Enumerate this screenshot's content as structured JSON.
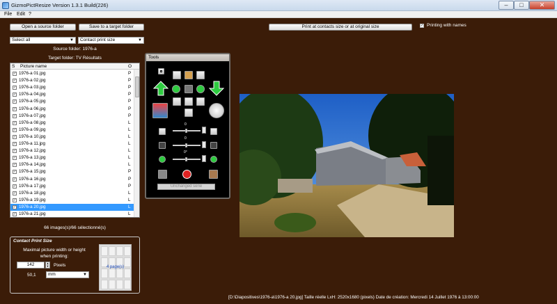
{
  "window": {
    "title": "GizmoPictResize  Version 1.3.1 Build(226)",
    "minimize": "–",
    "maximize": "□",
    "close": "✕"
  },
  "menu": [
    "File",
    "Edit",
    "?"
  ],
  "toolbar": {
    "open_source": "Open a source folder",
    "save_target": "Save to a target folder",
    "print_btn": "Print at contacts size or at original size",
    "printing_with_names": "Printing with names"
  },
  "selects": {
    "selection": "Select all",
    "mode": "Contact print size"
  },
  "folders": {
    "source": "Source folder: 1976-a",
    "target": "Target folder: TV Résultats"
  },
  "list": {
    "headers": {
      "s": "S",
      "name": "Picture name",
      "o": "O"
    },
    "rows": [
      {
        "name": "1976-a 01.jpg",
        "o": "P"
      },
      {
        "name": "1976-a 02.jpg",
        "o": "P"
      },
      {
        "name": "1976-a 03.jpg",
        "o": "P"
      },
      {
        "name": "1976-a 04.jpg",
        "o": "P"
      },
      {
        "name": "1976-a 05.jpg",
        "o": "P"
      },
      {
        "name": "1976-a 06.jpg",
        "o": "P"
      },
      {
        "name": "1976-a 07.jpg",
        "o": "P"
      },
      {
        "name": "1976-a 08.jpg",
        "o": "L"
      },
      {
        "name": "1976-a 09.jpg",
        "o": "L"
      },
      {
        "name": "1976-a 10.jpg",
        "o": "L"
      },
      {
        "name": "1976-a 11.jpg",
        "o": "L"
      },
      {
        "name": "1976-a 12.jpg",
        "o": "L"
      },
      {
        "name": "1976-a 13.jpg",
        "o": "L"
      },
      {
        "name": "1976-a 14.jpg",
        "o": "L"
      },
      {
        "name": "1976-a 15.jpg",
        "o": "P"
      },
      {
        "name": "1976-a 16.jpg",
        "o": "P"
      },
      {
        "name": "1976-a 17.jpg",
        "o": "P"
      },
      {
        "name": "1976-a 18.jpg",
        "o": "L"
      },
      {
        "name": "1976-a 19.jpg",
        "o": "L"
      },
      {
        "name": "1976-a 20.jpg",
        "o": "L"
      },
      {
        "name": "1976-a 21.jpg",
        "o": "L"
      }
    ],
    "selected_index": 19,
    "count": "66 images(s)/66 sélectionné(s)"
  },
  "tools": {
    "title": "Tools",
    "slider1_value": "0",
    "slider2_value": "0",
    "slider3_value": "0°",
    "unchanged": "Unchanged serie"
  },
  "contact": {
    "title": "Contact Print Size",
    "desc1": "Maximal picture width or height",
    "desc2": "when printing:",
    "width_value": "142",
    "unit_pixels": "Pixels",
    "mm_value": "50,1",
    "unit_select": "mm",
    "pages": "4 page(s)"
  },
  "status": {
    "text": "[D:\\Diapositives\\1976-a\\1976-a 20.jpg]   Taille réelle LxH: 2520x1680 (pixels)   Date de création: Mercredi 14 Juillet 1976 à 13:00:00"
  },
  "colors": {
    "background": "#3b1c08",
    "selection": "#3399ff",
    "arrow_green": "#2ecc40"
  }
}
